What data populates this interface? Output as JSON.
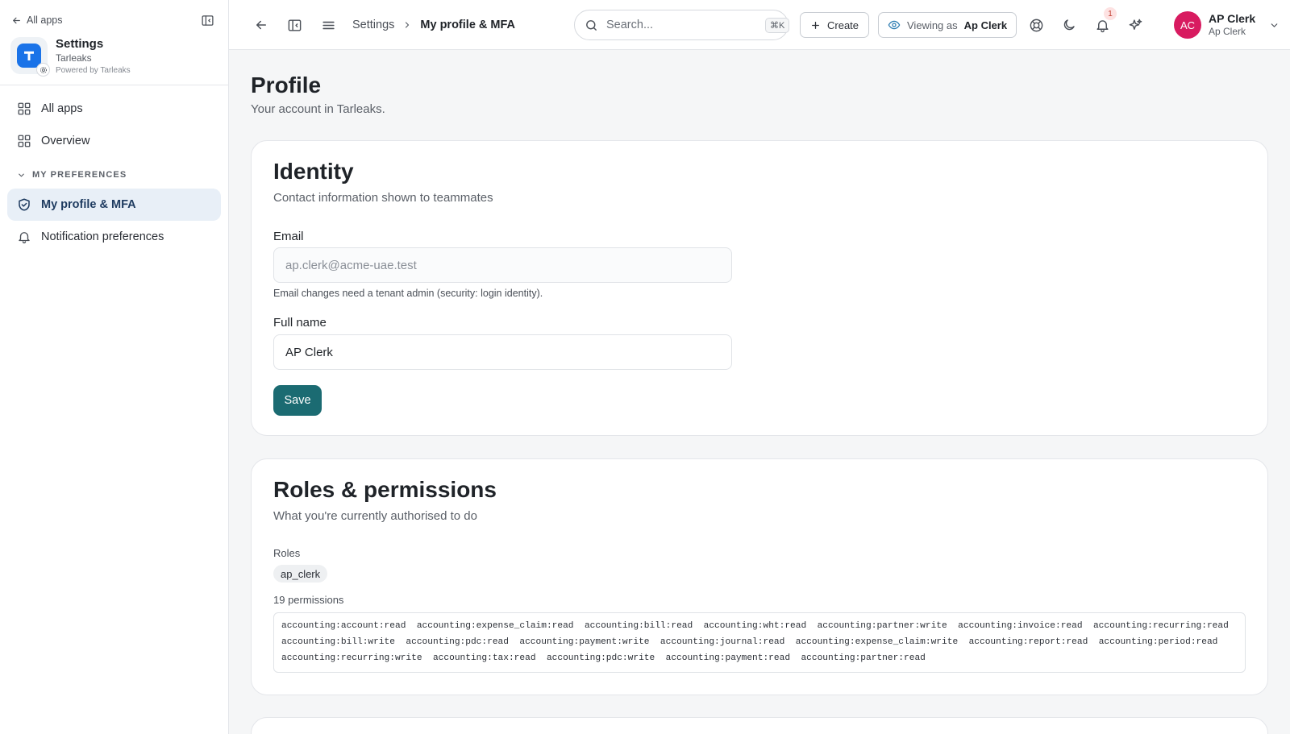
{
  "sidebar": {
    "back_label": "All apps",
    "app": {
      "name": "Settings",
      "org": "Tarleaks",
      "powered_by": "Powered by Tarleaks",
      "logo_letter": "T"
    },
    "items": [
      {
        "label": "All apps",
        "icon": "grid-icon"
      },
      {
        "label": "Overview",
        "icon": "grid-icon"
      }
    ],
    "section": {
      "label": "MY PREFERENCES",
      "expanded": true
    },
    "section_items": [
      {
        "label": "My profile & MFA",
        "icon": "shield-check-icon",
        "active": true
      },
      {
        "label": "Notification preferences",
        "icon": "bell-icon",
        "active": false
      }
    ]
  },
  "topbar": {
    "breadcrumb": {
      "parent": "Settings",
      "separator": "›",
      "current": "My profile & MFA"
    },
    "search": {
      "placeholder": "Search...",
      "shortcut": "⌘K"
    },
    "create_label": "Create",
    "viewing": {
      "prefix": "Viewing as",
      "name": "Ap Clerk"
    },
    "notifications_count": "1",
    "user": {
      "initials": "AC",
      "name": "AP Clerk",
      "role": "Ap Clerk"
    }
  },
  "page": {
    "title": "Profile",
    "subtitle": "Your account in Tarleaks."
  },
  "identity": {
    "title": "Identity",
    "subtitle": "Contact information shown to teammates",
    "email_label": "Email",
    "email_value": "ap.clerk@acme-uae.test",
    "email_hint": "Email changes need a tenant admin (security: login identity).",
    "name_label": "Full name",
    "name_value": "AP Clerk",
    "save_label": "Save"
  },
  "roles": {
    "title": "Roles & permissions",
    "subtitle": "What you're currently authorised to do",
    "roles_label": "Roles",
    "role_items": [
      "ap_clerk"
    ],
    "permissions_count_label": "19 permissions",
    "permissions": [
      "accounting:account:read",
      "accounting:expense_claim:read",
      "accounting:bill:read",
      "accounting:wht:read",
      "accounting:partner:write",
      "accounting:invoice:read",
      "accounting:recurring:read",
      "accounting:bill:write",
      "accounting:pdc:read",
      "accounting:payment:write",
      "accounting:journal:read",
      "accounting:expense_claim:write",
      "accounting:report:read",
      "accounting:period:read",
      "accounting:recurring:write",
      "accounting:tax:read",
      "accounting:pdc:write",
      "accounting:payment:read",
      "accounting:partner:read"
    ]
  },
  "colors": {
    "accent": "#1b6b72",
    "active_nav_bg": "#e8eff7",
    "avatar": "#d81b60",
    "logo": "#1a73e8"
  }
}
